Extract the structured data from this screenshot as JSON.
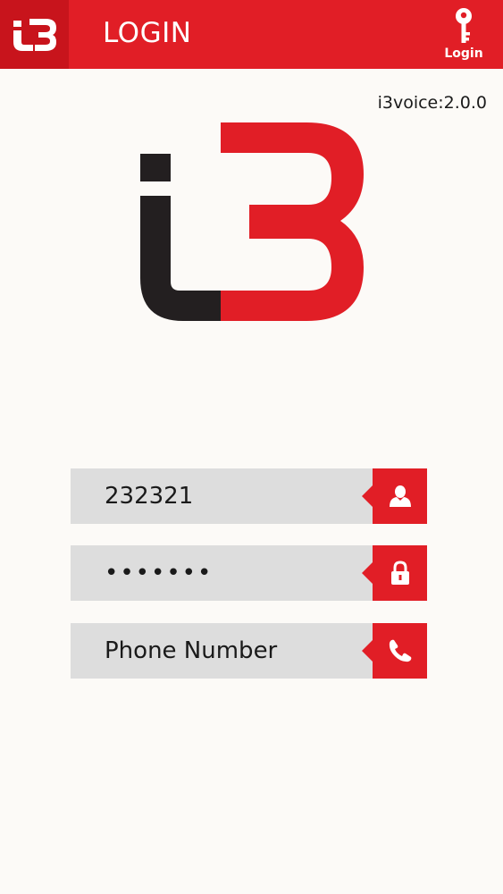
{
  "topbar": {
    "title": "LOGIN",
    "logo_icon": "i3-logo-icon",
    "login_button_label": "Login",
    "login_button_icon": "key-icon",
    "background_color": "#e11e26",
    "logo_background_color": "#c8141c"
  },
  "version": "i3voice:2.0.0",
  "brand_logo": {
    "icon": "i3-brand-logo",
    "dark_color": "#231f20",
    "red_color": "#e11e26"
  },
  "form": {
    "username": {
      "value": "232321",
      "icon": "user-icon"
    },
    "password": {
      "value": "1234567",
      "icon": "lock-icon"
    },
    "phone": {
      "value": "",
      "placeholder": "Phone Number",
      "icon": "phone-icon"
    }
  },
  "colors": {
    "accent": "#e11e26",
    "field_background": "#dddddd",
    "page_background": "#fcfaf7"
  }
}
